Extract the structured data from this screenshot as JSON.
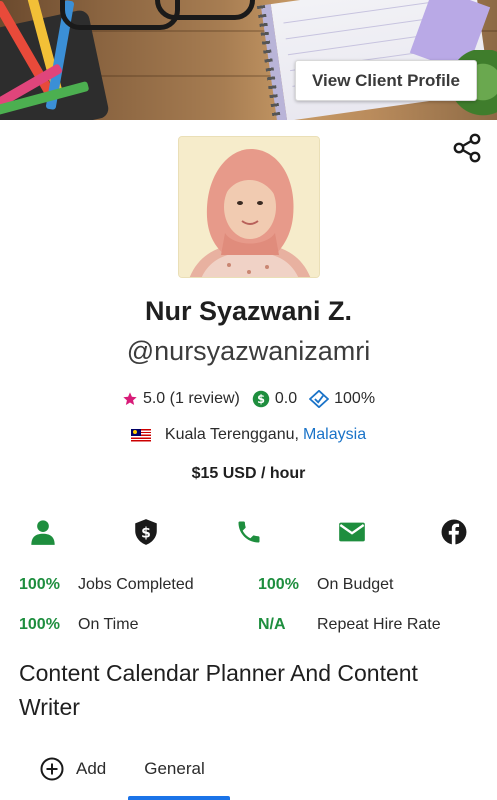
{
  "header": {
    "view_client_profile_label": "View Client Profile"
  },
  "profile": {
    "name": "Nur Syazwani Z.",
    "username": "@nursyazwanizamri",
    "rating": "5.0",
    "review_count": "(1 review)",
    "earnings_score": "0.0",
    "completion_rate": "100%",
    "city": "Kuala Terengganu,",
    "country": "Malaysia",
    "hourly_rate": "$15 USD / hour"
  },
  "contact_icons": [
    "user-icon",
    "verified-payment-icon",
    "phone-icon",
    "email-icon",
    "facebook-icon"
  ],
  "metrics": [
    {
      "value": "100%",
      "label": "Jobs Completed"
    },
    {
      "value": "100%",
      "label": "On Budget"
    },
    {
      "value": "100%",
      "label": "On Time"
    },
    {
      "value": "N/A",
      "label": "Repeat Hire Rate"
    }
  ],
  "job_title": "Content Calendar Planner And Content Writer",
  "bottom_nav": {
    "add_label": "Add",
    "general_label": "General"
  },
  "colors": {
    "accent_green": "#1e8e3e",
    "link_blue": "#1a73c8",
    "star_pink": "#d81b78"
  }
}
